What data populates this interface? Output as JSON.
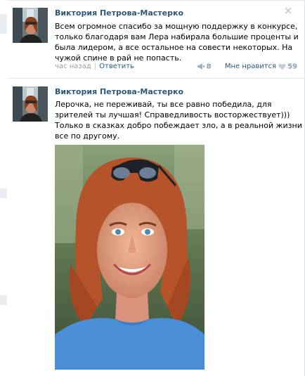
{
  "posts": [
    {
      "author": "Виктория Петрова-Мастерко",
      "text_lines": [
        "Всем огромное спасибо за мощную поддержку в конкурсе,",
        "только благодаря вам Лера набирала большие проценты и",
        "была лидером, а все остальное на совести некоторых. На",
        "чужой спине в рай не попасть."
      ],
      "time": "час назад",
      "separator": "|",
      "reply_label": "Ответить",
      "share_count": "8",
      "like_label": "Мне нравится",
      "like_count": "59",
      "close_icon": "close-icon"
    },
    {
      "author": "Виктория Петрова-Мастерко",
      "text_lines": [
        "Лерочка, не переживай, ты все равно победила, для",
        "зрителей ты лучшая! Справедливость восторжествует)))",
        "Только в сказках добро побеждает зло, а в реальной жизни",
        "все по другому."
      ]
    }
  ],
  "colors": {
    "author_link": "#2b587a",
    "meta_text": "#999999",
    "count_text": "#8aa1b4",
    "divider": "#e7eaed"
  }
}
